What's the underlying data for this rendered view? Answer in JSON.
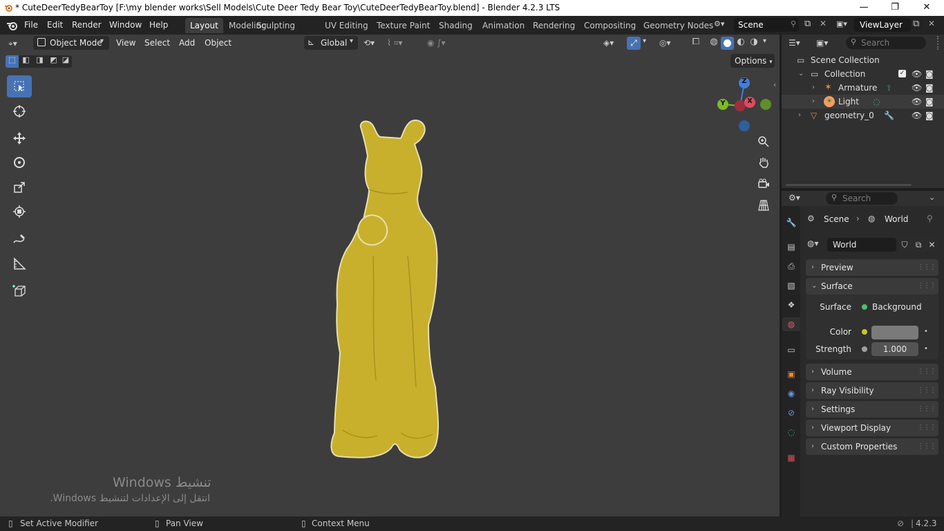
{
  "window": {
    "title": "* CuteDeerTedyBearToy [F:\\my blender works\\Sell Models\\Cute Deer Tedy Bear Toy\\CuteDeerTedyBearToy.blend] - Blender 4.2.3 LTS",
    "minimize": "—",
    "maximize": "❐",
    "close": "✕"
  },
  "menubar": {
    "items": [
      "File",
      "Edit",
      "Render",
      "Window",
      "Help"
    ]
  },
  "workspaces": {
    "tabs": [
      "Layout",
      "Modeling",
      "Sculpting",
      "UV Editing",
      "Texture Paint",
      "Shading",
      "Animation",
      "Rendering",
      "Compositing",
      "Geometry Nodes"
    ],
    "active": "Layout"
  },
  "scene_selector": {
    "value": "Scene"
  },
  "viewlayer_selector": {
    "value": "ViewLayer"
  },
  "viewport": {
    "mode": "Object Mode",
    "menus": [
      "View",
      "Select",
      "Add",
      "Object"
    ],
    "transform_orientation": "Global",
    "options_label": "Options",
    "gizmo_axes": {
      "x": "X",
      "y": "Y",
      "z": "Z"
    },
    "watermark_line1": "Windows تنشيط",
    "watermark_line2": ".Windows انتقل إلى الإعدادات لتنشيط",
    "model_color": "#c8b02c"
  },
  "outliner": {
    "search_placeholder": "Search",
    "root": "Scene Collection",
    "items": [
      {
        "label": "Collection"
      },
      {
        "label": "Armature"
      },
      {
        "label": "Light"
      },
      {
        "label": "geometry_0"
      }
    ]
  },
  "properties": {
    "search_placeholder": "Search",
    "breadcrumb": {
      "scene": "Scene",
      "world": "World"
    },
    "datablock": "World",
    "panels": {
      "preview": "Preview",
      "surface": "Surface",
      "volume": "Volume",
      "ray_visibility": "Ray Visibility",
      "settings": "Settings",
      "viewport_display": "Viewport Display",
      "custom_properties": "Custom Properties"
    },
    "surface_label": "Surface",
    "surface_value": "Background",
    "color_label": "Color",
    "color_value": "#7a7a7a",
    "strength_label": "Strength",
    "strength_value": "1.000"
  },
  "statusbar": {
    "left": "Set Active Modifier",
    "middle": "Pan View",
    "right": "Context Menu",
    "version": "4.2.3"
  }
}
